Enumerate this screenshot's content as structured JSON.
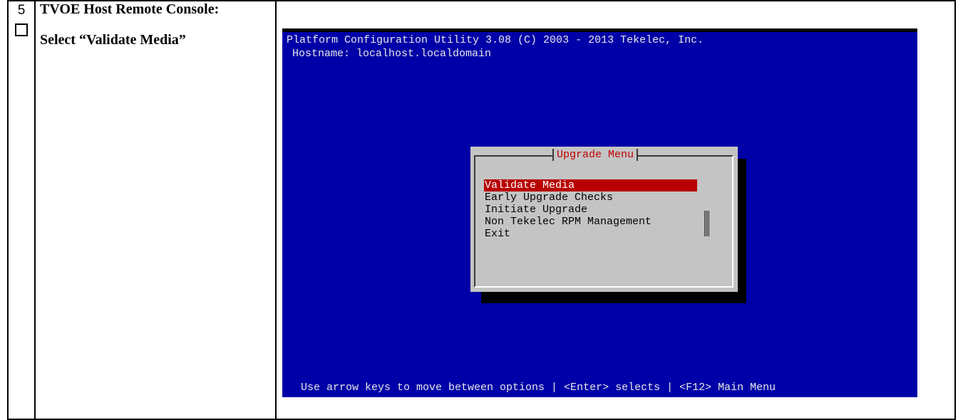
{
  "step": {
    "number": "5",
    "title": "TVOE Host Remote Console:",
    "action": "Select “Validate Media”"
  },
  "terminal": {
    "header": "Platform Configuration Utility 3.08 (C) 2003 - 2013 Tekelec, Inc.",
    "hostname": "Hostname: localhost.localdomain",
    "footer": "Use arrow keys to move between options | <Enter> selects | <F12> Main Menu",
    "colors": {
      "background": "#0000a8",
      "dialog": "#c4c4c4",
      "selection": "#b80000",
      "title": "#c00000"
    }
  },
  "menu": {
    "title": "Upgrade Menu",
    "items": [
      {
        "label": "Validate Media",
        "selected": true
      },
      {
        "label": "Early Upgrade Checks",
        "selected": false
      },
      {
        "label": "Initiate Upgrade",
        "selected": false
      },
      {
        "label": "Non Tekelec RPM Management",
        "selected": false
      },
      {
        "label": "Exit",
        "selected": false
      }
    ]
  }
}
